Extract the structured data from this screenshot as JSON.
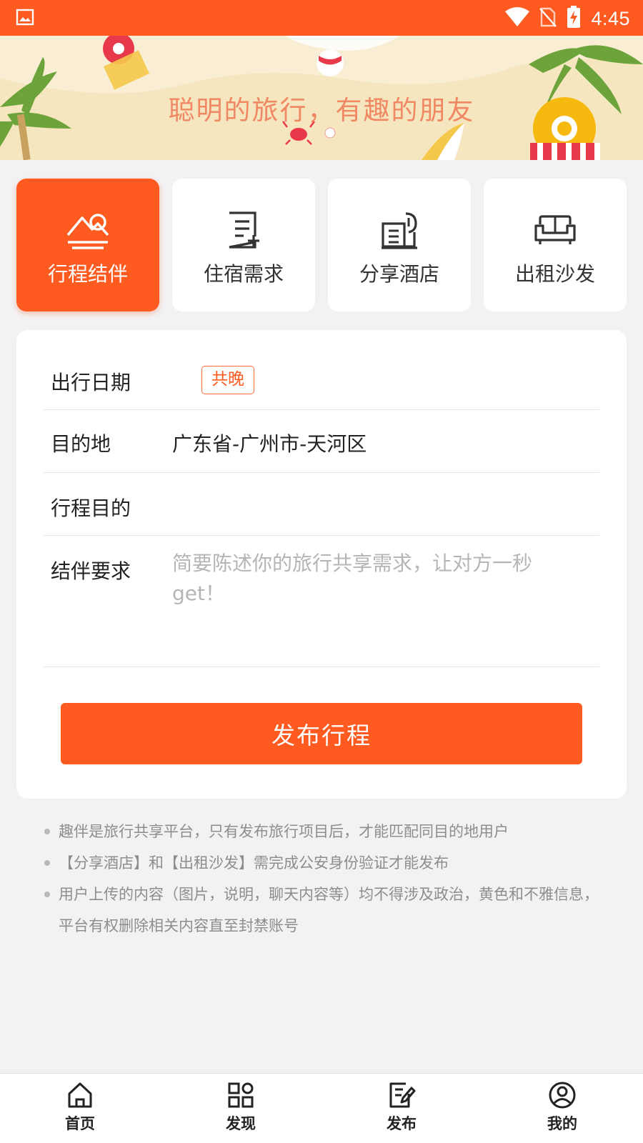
{
  "status_bar": {
    "time": "4:45",
    "icons": [
      "image-notification-icon",
      "wifi-icon",
      "no-sim-icon",
      "battery-charging-icon"
    ]
  },
  "banner": {
    "slogan": "聪明的旅行，有趣的朋友"
  },
  "categories": [
    {
      "label": "行程结伴",
      "icon": "mountain-icon",
      "active": true
    },
    {
      "label": "住宿需求",
      "icon": "document-add-icon",
      "active": false
    },
    {
      "label": "分享酒店",
      "icon": "hotel-building-icon",
      "active": false
    },
    {
      "label": "出租沙发",
      "icon": "sofa-icon",
      "active": false
    }
  ],
  "form": {
    "date": {
      "label": "出行日期",
      "badge": "共晚"
    },
    "destination": {
      "label": "目的地",
      "value": "广东省-广州市-天河区"
    },
    "purpose": {
      "label": "行程目的",
      "value": ""
    },
    "requirement": {
      "label": "结伴要求",
      "placeholder": "简要陈述你的旅行共享需求，让对方一秒get！",
      "value": ""
    },
    "submit_label": "发布行程"
  },
  "notes": [
    "趣伴是旅行共享平台，只有发布旅行项目后，才能匹配同目的地用户",
    "【分享酒店】和【出租沙发】需完成公安身份验证才能发布",
    "用户上传的内容（图片，说明，聊天内容等）均不得涉及政治，黄色和不雅信息，平台有权删除相关内容直至封禁账号"
  ],
  "bottom_nav": [
    {
      "label": "首页",
      "icon": "home-icon"
    },
    {
      "label": "发现",
      "icon": "discover-grid-icon"
    },
    {
      "label": "发布",
      "icon": "publish-edit-icon"
    },
    {
      "label": "我的",
      "icon": "profile-icon"
    }
  ],
  "colors": {
    "accent": "#ff5a1f",
    "background": "#f2f2f4",
    "banner": "#f6e6bf",
    "slogan": "#f08864"
  }
}
